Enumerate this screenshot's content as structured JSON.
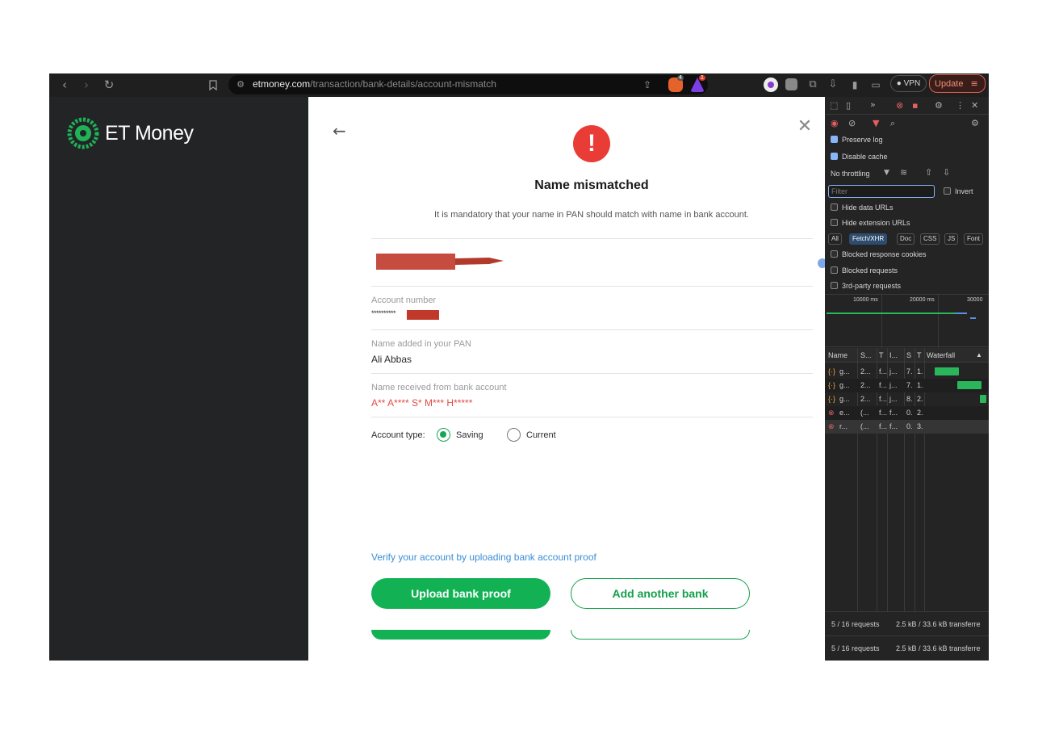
{
  "browser": {
    "url_host": "etmoney.com",
    "url_path": "/transaction/bank-details/account-mismatch",
    "vpn_label": "VPN",
    "update_label": "Update",
    "badge_counts": [
      "4",
      "1"
    ]
  },
  "sidebar": {
    "brand": "ET Money"
  },
  "modal": {
    "alert_symbol": "!",
    "title": "Name mismatched",
    "subtitle": "It is mandatory that your name in PAN should match with name in bank account.",
    "account_number_label": "Account number",
    "account_number_value": "**********",
    "pan_name_label": "Name added in your PAN",
    "pan_name_value": "Ali Abbas",
    "bank_name_label": "Name received from bank account",
    "bank_name_value": "A** A**** S* M*** H*****",
    "account_type_label": "Account type:",
    "account_types": [
      {
        "label": "Saving",
        "selected": true
      },
      {
        "label": "Current",
        "selected": false
      }
    ],
    "verify_link": "Verify your account by uploading bank account proof",
    "upload_button": "Upload bank proof",
    "add_bank_button": "Add another bank"
  },
  "devtools": {
    "preserve_log": "Preserve log",
    "disable_cache": "Disable cache",
    "throttling": "No throttling",
    "filter_placeholder": "Filter",
    "invert": "Invert",
    "hide_data_urls": "Hide data URLs",
    "hide_extension_urls": "Hide extension URLs",
    "type_chips": [
      "All",
      "Fetch/XHR",
      "Doc",
      "CSS",
      "JS",
      "Font"
    ],
    "blocked_cookies": "Blocked response cookies",
    "blocked_requests": "Blocked requests",
    "third_party": "3rd-party requests",
    "timeline_ticks": [
      "10000 ms",
      "20000 ms",
      "30000"
    ],
    "columns": [
      "Name",
      "S...",
      "T",
      "I...",
      "S",
      "T",
      "Waterfall"
    ],
    "requests": [
      {
        "name": "g...",
        "status": "2...",
        "type": "f...",
        "init": "j...",
        "size": "7.",
        "time": "1.",
        "error": false
      },
      {
        "name": "g...",
        "status": "2...",
        "type": "f...",
        "init": "j...",
        "size": "7.",
        "time": "1.",
        "error": false
      },
      {
        "name": "g...",
        "status": "2...",
        "type": "f...",
        "init": "j...",
        "size": "8.",
        "time": "2.",
        "error": false
      },
      {
        "name": "e...",
        "status": "(...",
        "type": "f...",
        "init": "f...",
        "size": "0.",
        "time": "2.",
        "error": true
      },
      {
        "name": "r...",
        "status": "(...",
        "type": "f...",
        "init": "f...",
        "size": "0.",
        "time": "3.",
        "error": true
      }
    ],
    "status_requests": "5 / 16 requests",
    "status_transfer": "2.5 kB / 33.6 kB transferre"
  },
  "colors": {
    "accent_green": "#12b254",
    "alert_red": "#e93c36",
    "link_blue": "#3a8ed6"
  }
}
